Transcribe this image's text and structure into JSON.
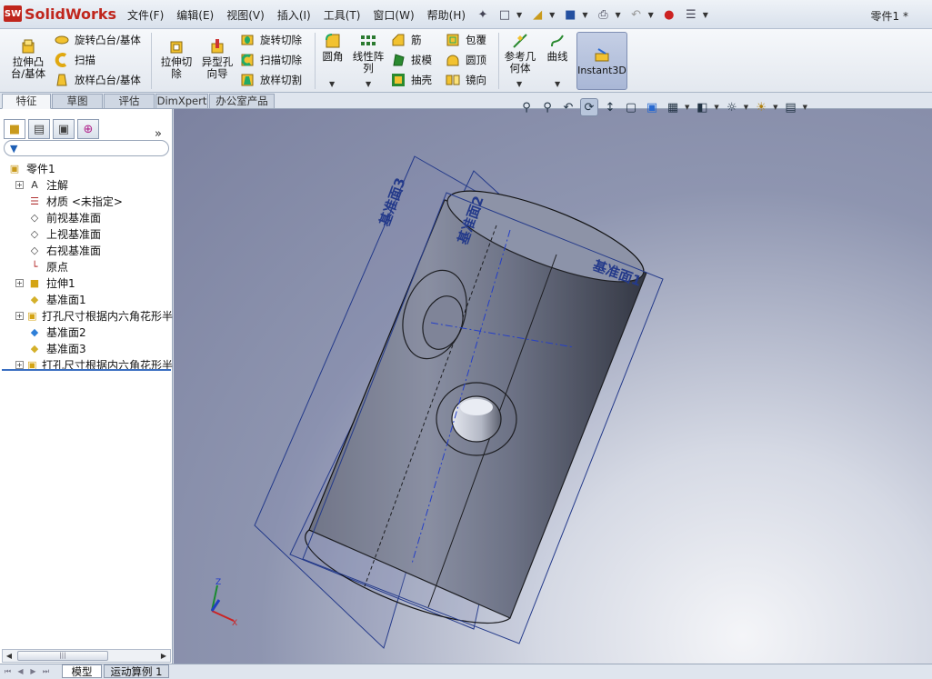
{
  "app": {
    "logo_text": "SolidWorks",
    "logo_badge": "SW",
    "doc_title": "零件1 *"
  },
  "menu": [
    "文件(F)",
    "编辑(E)",
    "视图(V)",
    "插入(I)",
    "工具(T)",
    "窗口(W)",
    "帮助(H)"
  ],
  "ribbon": {
    "extrude_boss": "拉伸凸\n台/基体",
    "revolve_boss": "旋转凸台/基体",
    "sweep": "扫描",
    "loft_boss": "放样凸台/基体",
    "extrude_cut": "拉伸切\n除",
    "hole_wizard": "异型孔\n向导",
    "revolve_cut": "旋转切除",
    "sweep_cut": "扫描切除",
    "loft_cut": "放样切割",
    "fillet": "圆角",
    "linear_pattern": "线性阵\n列",
    "rib": "筋",
    "draft": "拔模",
    "shell": "抽壳",
    "wrap": "包覆",
    "dome": "圆顶",
    "mirror": "镜向",
    "ref_geometry": "参考几\n何体",
    "curves": "曲线",
    "instant3d": "Instant3D"
  },
  "cm_tabs": [
    "特征",
    "草图",
    "评估",
    "DimXpert",
    "办公室产品"
  ],
  "cm_active": "特征",
  "tree": [
    {
      "label": "零件1",
      "icon": "part-icon",
      "indent": 0,
      "expand": ""
    },
    {
      "label": "注解",
      "icon": "annotation-icon",
      "indent": 1,
      "expand": "+"
    },
    {
      "label": "材质 <未指定>",
      "icon": "material-icon",
      "indent": 1,
      "expand": ""
    },
    {
      "label": "前视基准面",
      "icon": "plane-icon",
      "indent": 1,
      "expand": ""
    },
    {
      "label": "上视基准面",
      "icon": "plane-icon",
      "indent": 1,
      "expand": ""
    },
    {
      "label": "右视基准面",
      "icon": "plane-icon",
      "indent": 1,
      "expand": ""
    },
    {
      "label": "原点",
      "icon": "origin-icon",
      "indent": 1,
      "expand": ""
    },
    {
      "label": "拉伸1",
      "icon": "extrude-feature-icon",
      "indent": 1,
      "expand": "+"
    },
    {
      "label": "基准面1",
      "icon": "ref-plane-icon",
      "indent": 1,
      "expand": ""
    },
    {
      "label": "打孔尺寸根据内六角花形半",
      "icon": "hole-feature-icon",
      "indent": 1,
      "expand": "+"
    },
    {
      "label": "基准面2",
      "icon": "ref-plane-selected-icon",
      "indent": 1,
      "expand": ""
    },
    {
      "label": "基准面3",
      "icon": "ref-plane-icon",
      "indent": 1,
      "expand": ""
    },
    {
      "label": "打孔尺寸根据内六角花形半",
      "icon": "hole-feature-icon",
      "indent": 1,
      "expand": "+"
    }
  ],
  "bottom_tabs": [
    "模型",
    "运动算例 1"
  ],
  "bottom_active": "模型",
  "viewport": {
    "plane_labels": [
      "基准面3",
      "基准面2",
      "基准面1"
    ]
  },
  "colors": {
    "brand_red": "#c0261d",
    "selection_blue": "#3a6fc2",
    "plane_line": "#243a8a"
  }
}
